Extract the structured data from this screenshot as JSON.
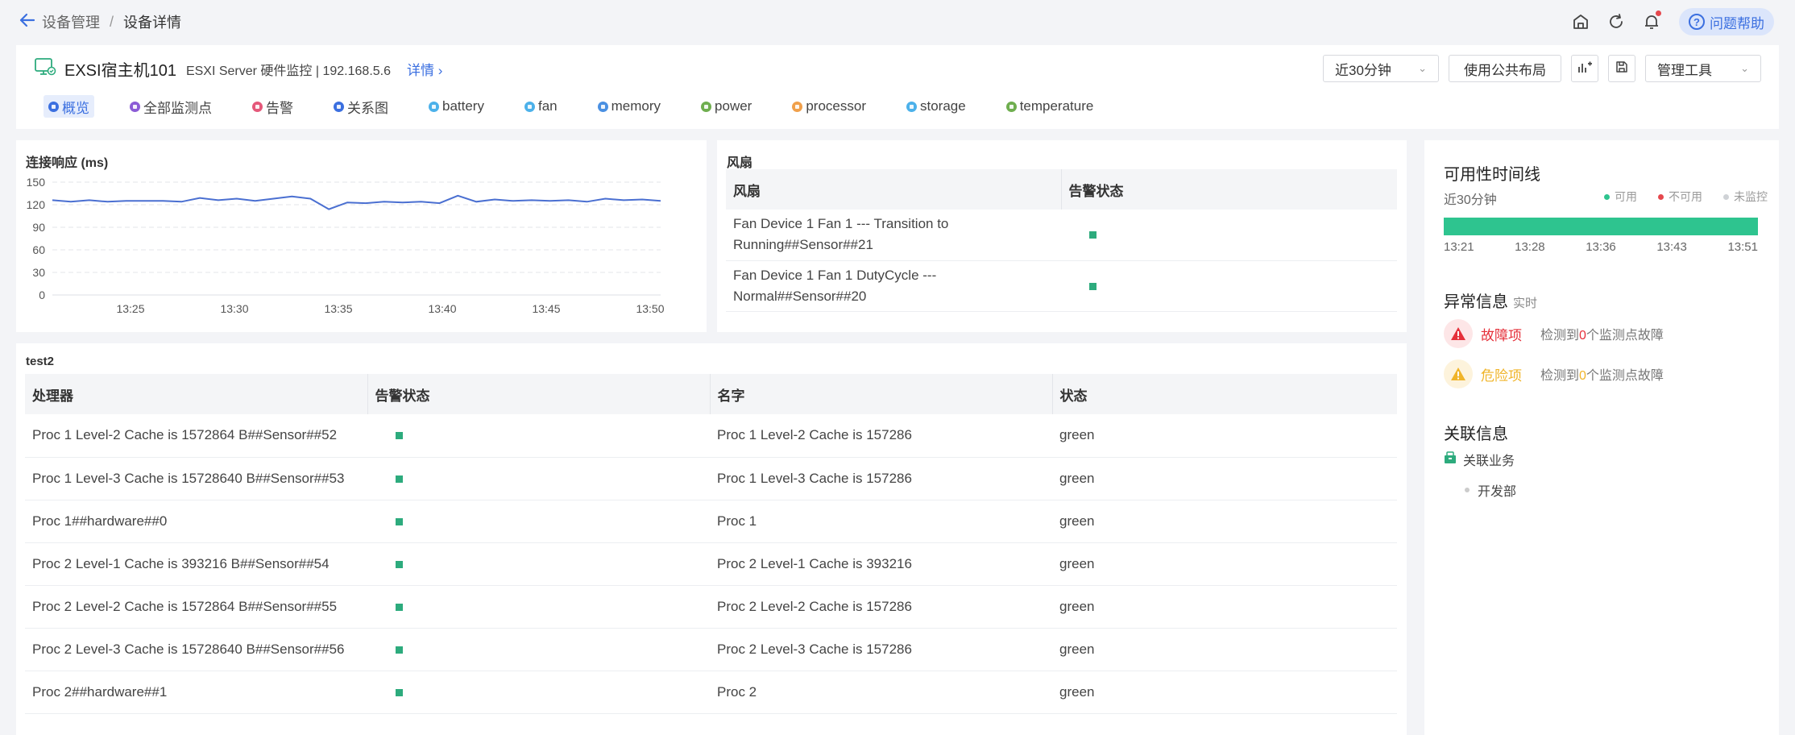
{
  "breadcrumb": {
    "parent": "设备管理",
    "separator": "/",
    "current": "设备详情"
  },
  "topbar": {
    "help_label": "问题帮助"
  },
  "device": {
    "name": "EXSI宿主机101",
    "description": "ESXI Server 硬件监控 | 192.168.5.6",
    "detail_link": "详情"
  },
  "controls": {
    "time_range": "近30分钟",
    "public_layout": "使用公共布局",
    "manage_tools": "管理工具"
  },
  "tabs": [
    {
      "label": "概览",
      "color": "#3b6fe0",
      "active": true
    },
    {
      "label": "全部监测点",
      "color": "#8b5bd6",
      "active": false
    },
    {
      "label": "告警",
      "color": "#e5587a",
      "active": false
    },
    {
      "label": "关系图",
      "color": "#3b6fe0",
      "active": false
    },
    {
      "label": "battery",
      "color": "#4cb1ea",
      "active": false
    },
    {
      "label": "fan",
      "color": "#4cb1ea",
      "active": false
    },
    {
      "label": "memory",
      "color": "#4a90e2",
      "active": false
    },
    {
      "label": "power",
      "color": "#6fae4f",
      "active": false
    },
    {
      "label": "processor",
      "color": "#f0a04b",
      "active": false
    },
    {
      "label": "storage",
      "color": "#4cb1ea",
      "active": false
    },
    {
      "label": "temperature",
      "color": "#6fae4f",
      "active": false
    }
  ],
  "response_chart": {
    "title": "连接响应 (ms)",
    "color": "#4a6fd1"
  },
  "chart_data": {
    "type": "line",
    "title": "连接响应 (ms)",
    "xlabel": "",
    "ylabel": "",
    "ylim": [
      0,
      150
    ],
    "yticks": [
      0,
      30,
      60,
      90,
      120,
      150
    ],
    "xticks": [
      "13:25",
      "13:30",
      "13:35",
      "13:40",
      "13:45",
      "13:50"
    ],
    "x_minutes": [
      21.5,
      22.5,
      23.5,
      24.5,
      25.5,
      26.5,
      27.5,
      28.5,
      29.5,
      30.5,
      31.5,
      32.5,
      33.5,
      34.5,
      35.5,
      36.5,
      37.5,
      38.5,
      39.5,
      40.5,
      41.5,
      42.5,
      43.5,
      44.5,
      45.5,
      46.5,
      47.5,
      48.5,
      49.5,
      50.5
    ],
    "x_start_minute": 21.5,
    "series": [
      {
        "values": [
          126,
          124,
          126,
          124,
          125,
          125,
          125,
          124,
          129,
          126,
          128,
          125,
          128,
          131,
          128,
          114,
          123,
          122,
          124,
          123,
          124,
          122,
          132,
          124,
          127,
          125,
          126,
          125,
          126,
          124,
          128,
          126,
          127,
          125
        ]
      }
    ],
    "grid": true
  },
  "fan_table": {
    "title": "风扇",
    "columns": [
      "风扇",
      "告警状态"
    ],
    "rows": [
      {
        "name_line1": "Fan Device 1 Fan 1 --- Transition to",
        "name_line2": "Running##Sensor##21"
      },
      {
        "name_line1": "Fan Device 1 Fan 1 DutyCycle ---",
        "name_line2": "Normal##Sensor##20"
      }
    ],
    "status_color": "#2dab7d"
  },
  "proc_table": {
    "title": "test2",
    "columns": [
      "处理器",
      "告警状态",
      "名字",
      "状态"
    ],
    "rows": [
      {
        "processor": "Proc 1 Level-2 Cache is 1572864 B##Sensor##52",
        "name": "Proc 1 Level-2 Cache is 157286",
        "state": "green"
      },
      {
        "processor": "Proc 1 Level-3 Cache is 15728640 B##Sensor##53",
        "name": "Proc 1 Level-3 Cache is 157286",
        "state": "green"
      },
      {
        "processor": "Proc 1##hardware##0",
        "name": "Proc 1",
        "state": "green"
      },
      {
        "processor": "Proc 2 Level-1 Cache is 393216 B##Sensor##54",
        "name": "Proc 2 Level-1 Cache is 393216",
        "state": "green"
      },
      {
        "processor": "Proc 2 Level-2 Cache is 1572864 B##Sensor##55",
        "name": "Proc 2 Level-2 Cache is 157286",
        "state": "green"
      },
      {
        "processor": "Proc 2 Level-3 Cache is 15728640 B##Sensor##56",
        "name": "Proc 2 Level-3 Cache is 157286",
        "state": "green"
      },
      {
        "processor": "Proc 2##hardware##1",
        "name": "Proc 2",
        "state": "green"
      }
    ]
  },
  "availability": {
    "title": "可用性时间线",
    "range": "近30分钟",
    "legend": [
      {
        "label": "可用",
        "color": "#2ec48f"
      },
      {
        "label": "不可用",
        "color": "#e5484d"
      },
      {
        "label": "未监控",
        "color": "#cfd2d6"
      }
    ],
    "bar_color": "#2ec48f",
    "ticks": [
      "13:21",
      "13:28",
      "13:36",
      "13:43",
      "13:51"
    ]
  },
  "anomaly": {
    "title": "异常信息",
    "subtitle": "实时",
    "items": [
      {
        "label": "故障项",
        "prefix": "检测到",
        "count": "0",
        "suffix": "个监测点故障",
        "color": "#e5303a",
        "bg": "#fde6e7"
      },
      {
        "label": "危险项",
        "prefix": "检测到",
        "count": "0",
        "suffix": "个监测点故障",
        "color": "#f0b429",
        "bg": "#fdf3dc"
      }
    ]
  },
  "related": {
    "title": "关联信息",
    "business_label": "关联业务",
    "items": [
      "开发部"
    ]
  }
}
